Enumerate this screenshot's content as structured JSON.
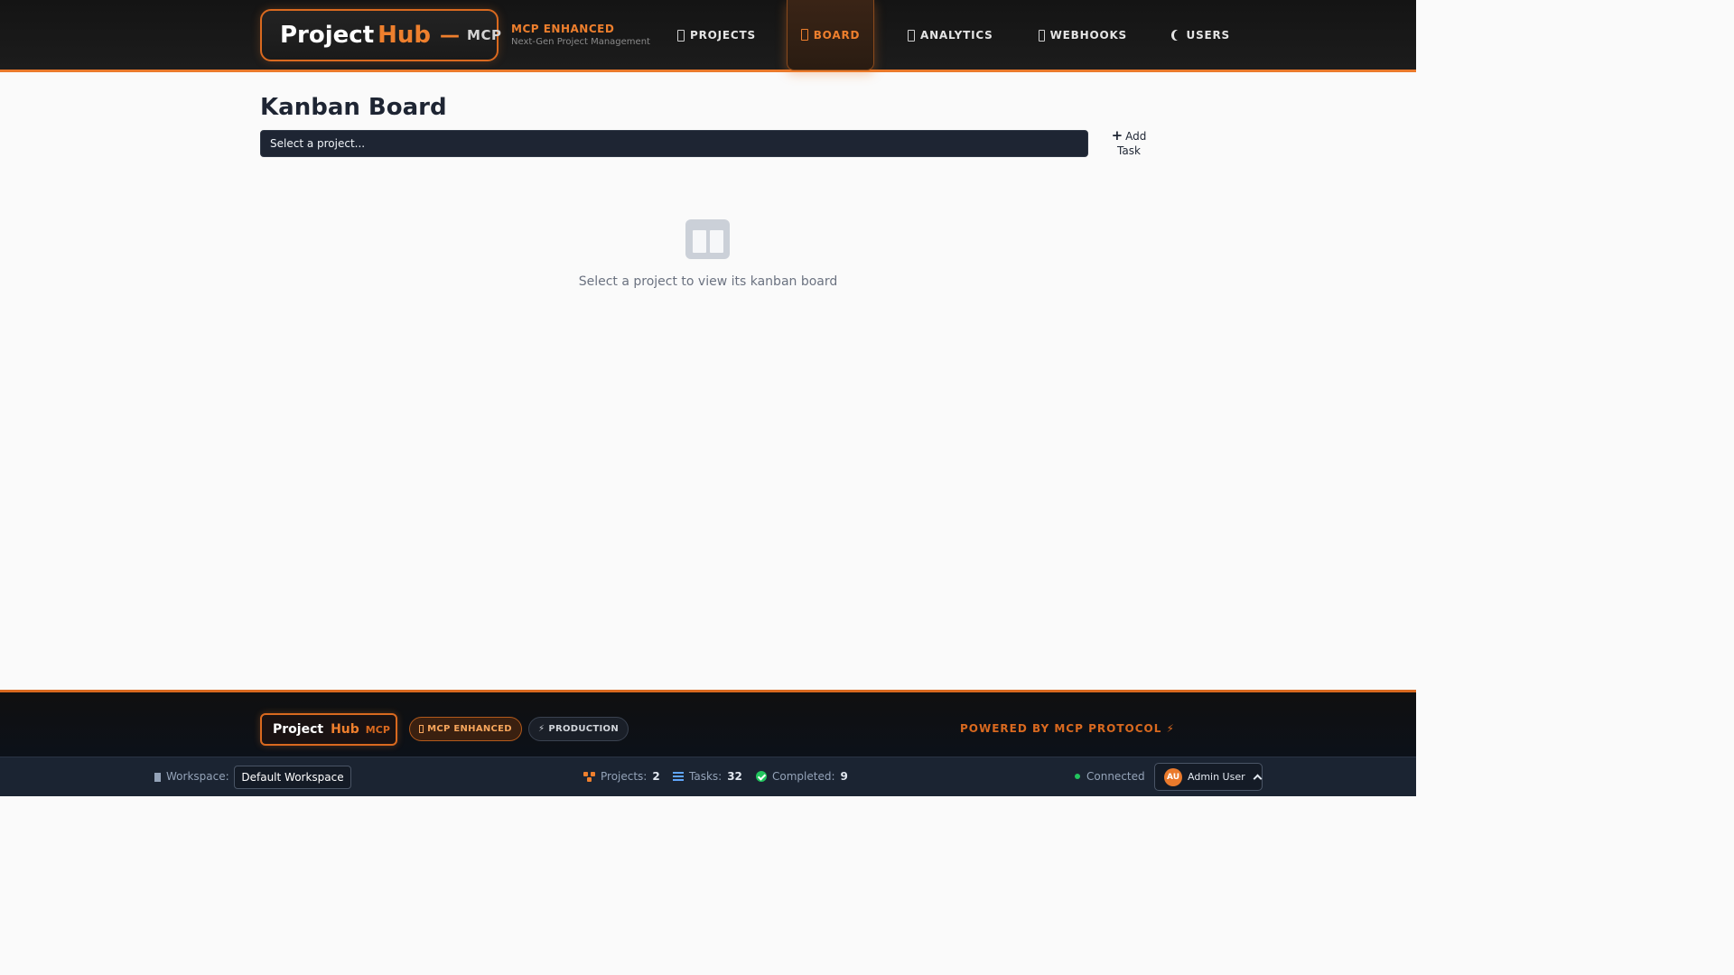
{
  "header": {
    "logo": {
      "project": "Project",
      "hub": "Hub",
      "dash": "—",
      "mcp": "MCP"
    },
    "brand_tag": {
      "title": "MCP ENHANCED",
      "subtitle": "Next-Gen Project Management"
    },
    "nav": [
      {
        "label": "PROJECTS",
        "icon": "folder-icon",
        "active": false
      },
      {
        "label": "BOARD",
        "icon": "board-icon",
        "active": true
      },
      {
        "label": "ANALYTICS",
        "icon": "chart-icon",
        "active": false
      },
      {
        "label": "WEBHOOKS",
        "icon": "webhook-icon",
        "active": false
      },
      {
        "label": "USERS",
        "icon": "users-icon",
        "active": false
      }
    ],
    "theme_toggle_icon": "moon-icon"
  },
  "main": {
    "title": "Kanban Board",
    "project_select": {
      "value": "Select a project..."
    },
    "add_task": {
      "plus": "+",
      "label": "Add Task"
    },
    "empty_state": {
      "icon": "columns-icon",
      "text": "Select a project to view its kanban board"
    }
  },
  "footer": {
    "logo": {
      "project": "Project",
      "hub": "Hub",
      "mcp": "MCP"
    },
    "badges": [
      {
        "label": "MCP ENHANCED",
        "icon": "rocket-icon"
      },
      {
        "label": "PRODUCTION",
        "icon": "lightning-icon",
        "glyph": "⚡"
      }
    ],
    "powered_by": "POWERED BY MCP PROTOCOL ⚡"
  },
  "statusbar": {
    "workspace_label": "Workspace:",
    "workspace_value": "Default Workspace",
    "stats": [
      {
        "label": "Projects:",
        "value": "2",
        "icon": "project-diagram-icon"
      },
      {
        "label": "Tasks:",
        "value": "32",
        "icon": "tasks-list-icon"
      },
      {
        "label": "Completed:",
        "value": "9",
        "icon": "check-circle-icon"
      }
    ],
    "connection": "Connected",
    "user": {
      "initials": "AU",
      "name": "Admin User"
    }
  },
  "colors": {
    "accent": "#ea7a2c",
    "header_bg": "#141414",
    "select_bg": "#1e2533",
    "status_bg": "#1b2432",
    "success": "#22c55e"
  }
}
